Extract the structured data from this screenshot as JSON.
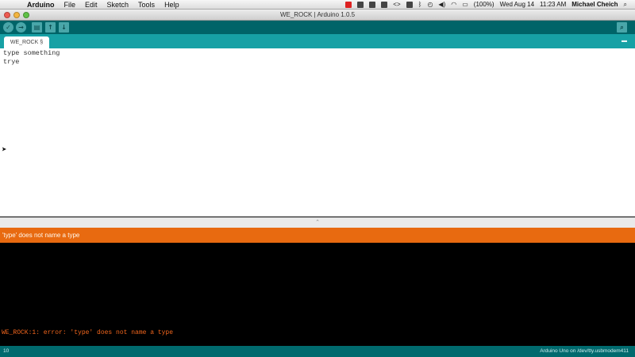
{
  "menubar": {
    "app_name": "Arduino",
    "items": [
      "File",
      "Edit",
      "Sketch",
      "Tools",
      "Help"
    ],
    "status": {
      "battery": "(100%)",
      "date": "Wed Aug 14",
      "time": "11:23 AM",
      "user": "Michael Cheich"
    }
  },
  "window": {
    "title": "WE_ROCK | Arduino 1.0.5"
  },
  "toolbar": {
    "buttons": [
      "verify-icon",
      "upload-icon",
      "new-icon",
      "open-icon",
      "save-icon",
      "serial-monitor-icon"
    ]
  },
  "tabs": {
    "active": "WE_ROCK §"
  },
  "editor": {
    "lines": [
      "type something",
      "trye"
    ]
  },
  "error_banner": {
    "message": "'type' does not name a type"
  },
  "console": {
    "line": "WE_ROCK:1: error: 'type' does not name a type"
  },
  "footer": {
    "line_number": "10",
    "board": "Arduino Uno on /dev/tty.usbmodem411"
  },
  "colors": {
    "toolbar": "#006468",
    "tabbar": "#17a1a5",
    "error": "#e86a10",
    "console_text": "#f2661d"
  }
}
